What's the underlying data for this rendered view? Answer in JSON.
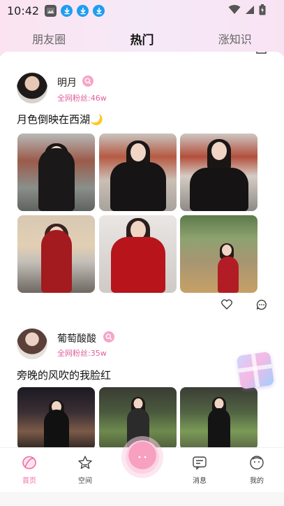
{
  "status_bar": {
    "time": "10:42",
    "icons": [
      "gallery-icon",
      "download-icon",
      "download-icon",
      "download-icon"
    ],
    "right_icons": [
      "wifi-icon",
      "signal-icon",
      "battery-icon"
    ]
  },
  "tabs": [
    {
      "label": "朋友圈",
      "active": false
    },
    {
      "label": "热门",
      "active": true
    },
    {
      "label": "涨知识",
      "active": false
    }
  ],
  "posts": [
    {
      "name": "明月",
      "fans": "全网粉丝:46w",
      "caption": "月色倒映在西湖🌙",
      "photos": 6
    },
    {
      "name": "葡萄酸酸",
      "fans": "全网粉丝:35w",
      "caption": "旁晚的风吹的我脸红",
      "photos": 3
    }
  ],
  "bottom_nav": [
    {
      "label": "首页",
      "icon": "home-icon",
      "active": true
    },
    {
      "label": "空间",
      "icon": "star-icon",
      "active": false
    },
    {
      "label": "",
      "icon": "center-face-icon",
      "active": false
    },
    {
      "label": "消息",
      "icon": "message-icon",
      "active": false
    },
    {
      "label": "我的",
      "icon": "profile-icon",
      "active": false
    }
  ],
  "colors": {
    "accent": "#f06fa8",
    "tab_underline": "#f58bb9",
    "fans_text": "#e0609c",
    "header_gradient": "#fbe3f1"
  }
}
